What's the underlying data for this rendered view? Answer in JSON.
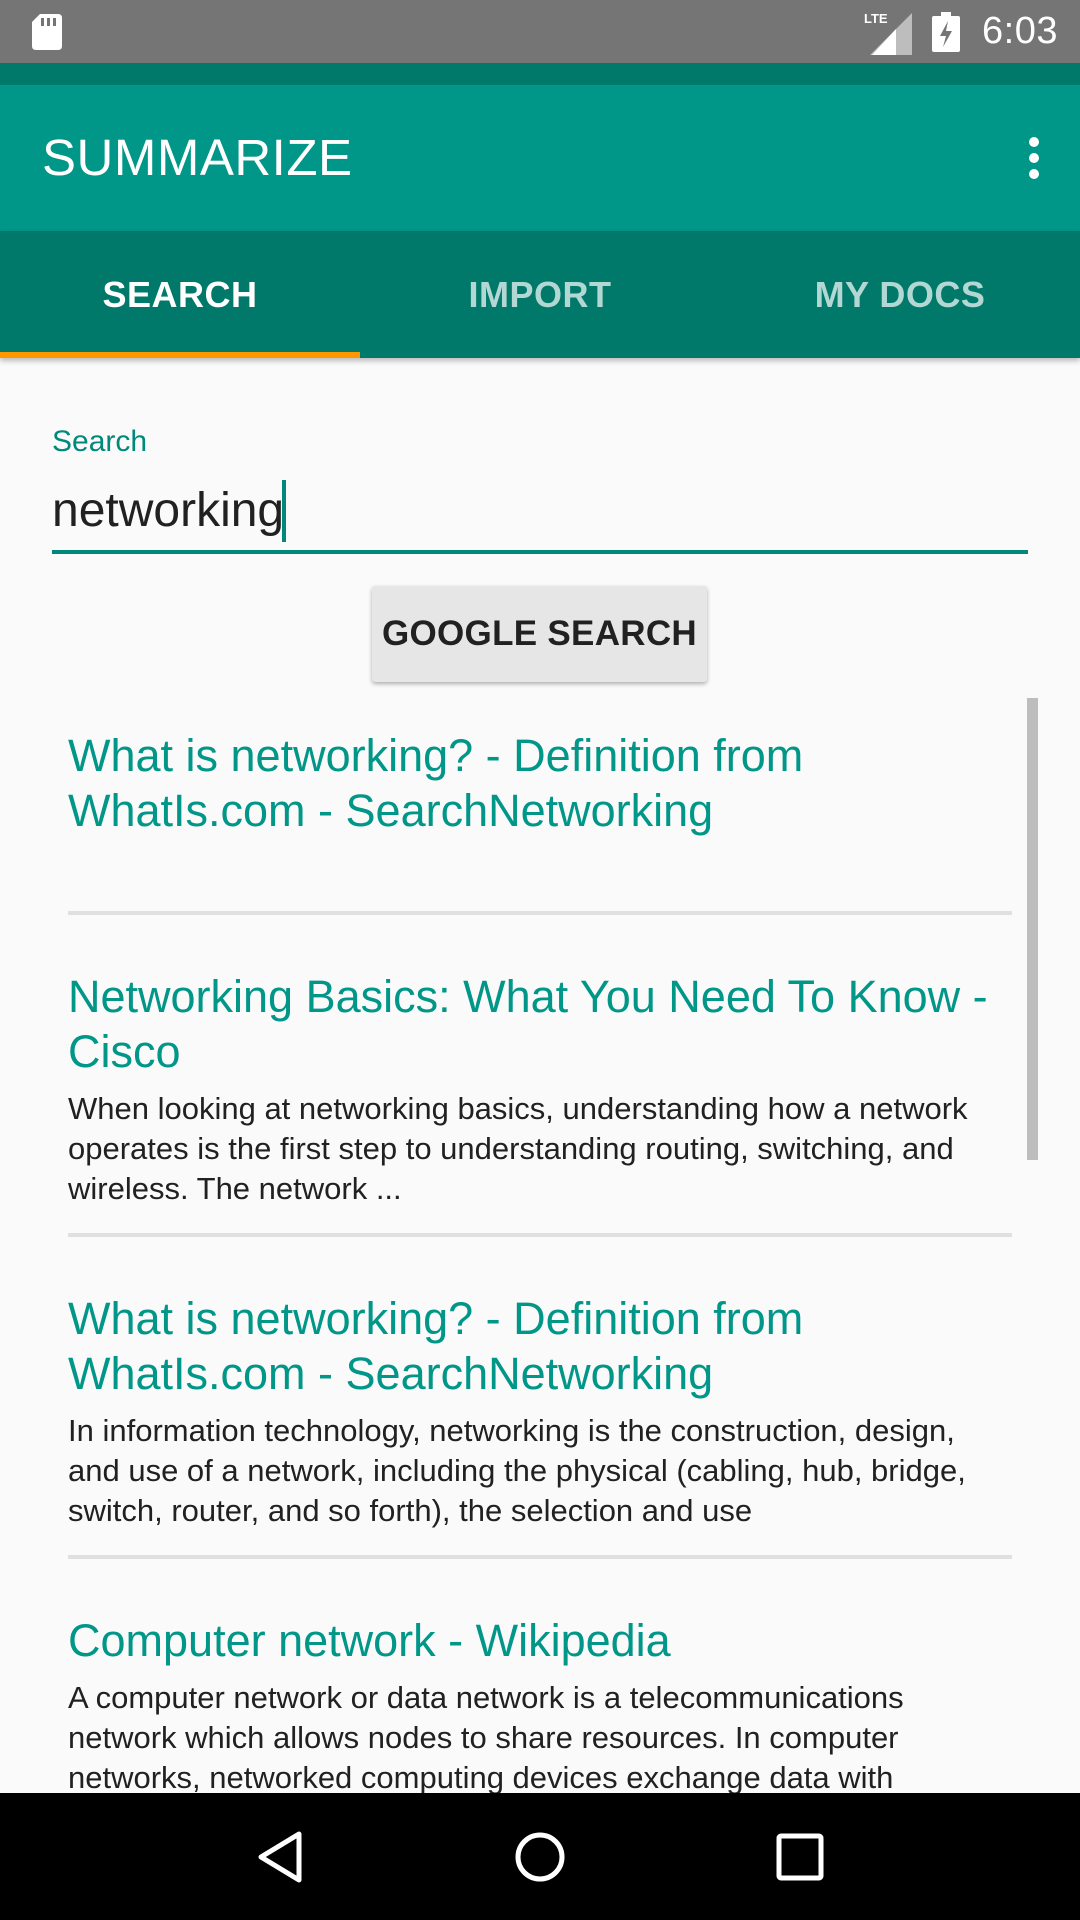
{
  "status_bar": {
    "time": "6:03",
    "network": "LTE",
    "icons": [
      "sd-card-icon",
      "lte-signal-icon",
      "battery-charging-icon"
    ]
  },
  "app_bar": {
    "title": "SUMMARIZE",
    "menu_icon": "more-vert-icon"
  },
  "tabs": [
    {
      "label": "SEARCH",
      "active": true
    },
    {
      "label": "IMPORT",
      "active": false
    },
    {
      "label": "MY DOCS",
      "active": false
    }
  ],
  "search": {
    "label": "Search",
    "value": "networking"
  },
  "google_button": {
    "label": "GOOGLE SEARCH"
  },
  "results": [
    {
      "title": "What is networking? - Definition from WhatIs.com - SearchNetworking",
      "snippet": ""
    },
    {
      "title": "Networking Basics: What You Need To Know - Cisco",
      "snippet": "When looking at networking basics, understanding how a network operates is the first step to understanding routing, switching, and wireless. The network ..."
    },
    {
      "title": "What is networking? - Definition from WhatIs.com - SearchNetworking",
      "snippet": "In information technology, networking is the construction, design, and use of a network, including the physical (cabling, hub, bridge, switch, router, and so forth), the selection and use"
    },
    {
      "title": "Computer network - Wikipedia",
      "snippet": "A computer network or data network is a telecommunications network which allows nodes to share resources. In computer networks, networked computing devices exchange data with"
    }
  ],
  "nav_bar": {
    "icons": [
      "back-icon",
      "home-icon",
      "recents-icon"
    ]
  },
  "colors": {
    "primary": "#009688",
    "primary_dark": "#00796b",
    "accent": "#ff9800",
    "status_bar": "#757575"
  }
}
